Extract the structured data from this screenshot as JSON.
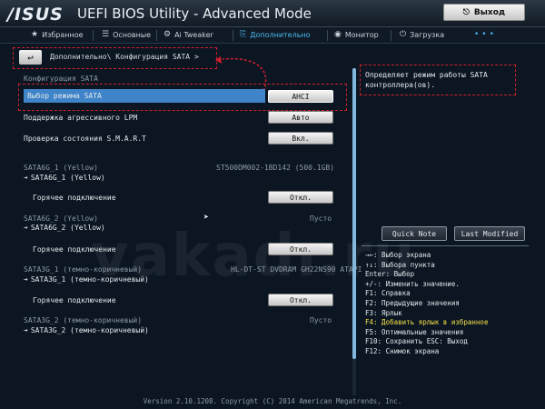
{
  "header": {
    "logo": "/ISUS",
    "title": "UEFI BIOS Utility - Advanced Mode",
    "exit_label": "Выход"
  },
  "tabs": [
    {
      "label": "Избранное",
      "icon": "star-icon"
    },
    {
      "label": "Основные",
      "icon": "list-icon"
    },
    {
      "label": "Ai Tweaker",
      "icon": "tweaker-icon"
    },
    {
      "label": "Дополнительно",
      "icon": "advanced-icon",
      "active": true
    },
    {
      "label": "Монитор",
      "icon": "monitor-icon"
    },
    {
      "label": "Загрузка",
      "icon": "power-icon"
    }
  ],
  "breadcrumb": "Дополнительно\\ Конфигурация SATA >",
  "section_title": "Конфигурация SATA",
  "settings": {
    "sata_mode": {
      "label": "Выбор режима SATA",
      "value": "AHCI"
    },
    "lpm": {
      "label": "Поддержка агрессивного LPM",
      "value": "Авто"
    },
    "smart": {
      "label": "Проверка состояния S.M.A.R.T",
      "value": "Вкл."
    }
  },
  "ports": [
    {
      "header": "SATA6G_1 (Yellow)",
      "device": "ST500DM002-1BD142 (500.1GB)",
      "sub": "SATA6G_1 (Yellow)",
      "hotplug_label": "Горячее подключение",
      "hotplug_value": "Откл."
    },
    {
      "header": "SATA6G_2 (Yellow)",
      "device": "Пусто",
      "sub": "SATA6G_2 (Yellow)",
      "hotplug_label": "Горячее подключение",
      "hotplug_value": "Откл."
    },
    {
      "header": "SATA3G_1 (темно-коричневый)",
      "device": "HL-DT-ST DVDRAM GH22NS90 ATAPI",
      "sub": "SATA3G_1 (темно-коричневый)",
      "hotplug_label": "Горячее подключение",
      "hotplug_value": "Откл."
    },
    {
      "header": "SATA3G_2 (темно-коричневый)",
      "device": "Пусто",
      "sub": "SATA3G_2 (темно-коричневый)"
    }
  ],
  "help": {
    "text": "Определяет режим работы SATA контроллера(ов).",
    "quick_note": "Quick Note",
    "last_modified": "Last Modified"
  },
  "keys": [
    {
      "text": "→←: Выбор экрана",
      "highlight": false
    },
    {
      "text": "↑↓: Выбора пункта",
      "highlight": false
    },
    {
      "text": "Enter: Выбор",
      "highlight": false
    },
    {
      "text": "+/-: Изменить значение.",
      "highlight": false
    },
    {
      "text": "F1: Справка",
      "highlight": false
    },
    {
      "text": "F2: Предыдущие значения",
      "highlight": false
    },
    {
      "text": "F3: Ярлык",
      "highlight": false
    },
    {
      "text": "F4: Добавить ярлык в избранное",
      "highlight": true
    },
    {
      "text": "F5: Оптимальные значения",
      "highlight": false
    },
    {
      "text": "F10: Сохранить ESC: Выход",
      "highlight": false
    },
    {
      "text": "F12: Снимок экрана",
      "highlight": false
    }
  ],
  "footer": "Version 2.10.1208. Copyright (C) 2014 American Megatrends, Inc.",
  "watermark": "vakadr.ru",
  "colors": {
    "accent": "#4db8f0",
    "highlight_row": "#3f84c8",
    "annotation": "#d0202a",
    "key_highlight": "#f5e04a"
  }
}
